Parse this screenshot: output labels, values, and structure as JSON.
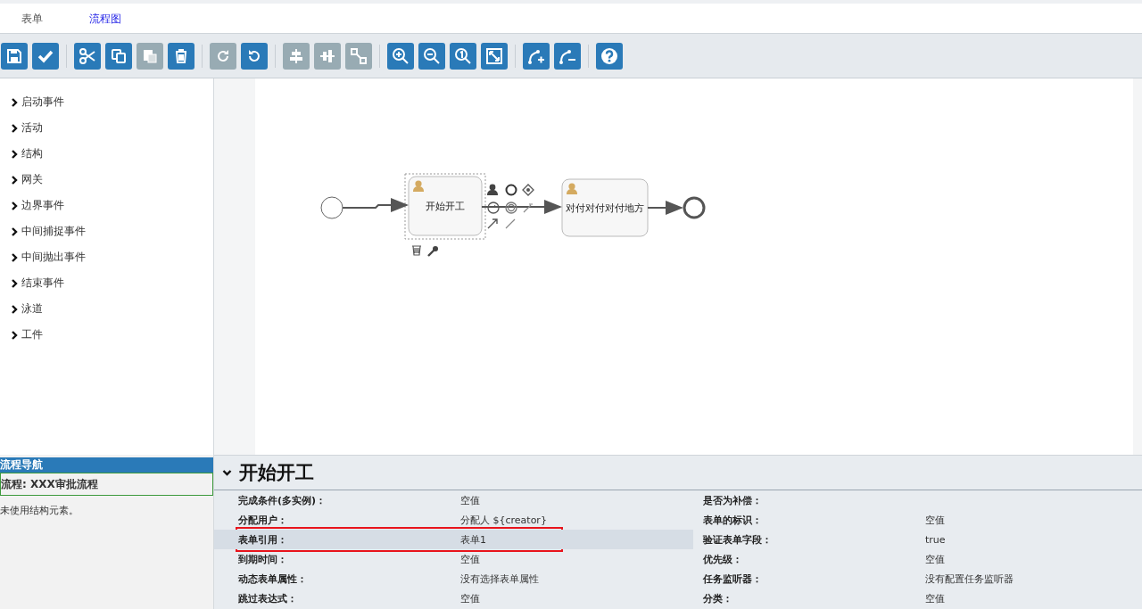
{
  "tabs": [
    {
      "label": "表单",
      "selected": false
    },
    {
      "label": "流程图",
      "selected": true
    }
  ],
  "toolbar": [
    [
      {
        "kind": "save",
        "disabled": false
      },
      {
        "kind": "validate",
        "disabled": false
      }
    ],
    [
      {
        "kind": "cut",
        "disabled": false
      },
      {
        "kind": "copy",
        "disabled": false
      },
      {
        "kind": "paste",
        "disabled": true
      },
      {
        "kind": "delete",
        "disabled": false
      }
    ],
    [
      {
        "kind": "redo",
        "disabled": true
      },
      {
        "kind": "undo",
        "disabled": false
      }
    ],
    [
      {
        "kind": "align-horizontal",
        "disabled": true
      },
      {
        "kind": "align-vertical",
        "disabled": true
      },
      {
        "kind": "same-size",
        "disabled": true
      }
    ],
    [
      {
        "kind": "zoom-in",
        "disabled": false
      },
      {
        "kind": "zoom-out",
        "disabled": false
      },
      {
        "kind": "zoom-actual",
        "disabled": false
      },
      {
        "kind": "zoom-fit",
        "disabled": false
      }
    ],
    [
      {
        "kind": "add-bendpoint",
        "disabled": false
      },
      {
        "kind": "remove-bendpoint",
        "disabled": false
      }
    ],
    [
      {
        "kind": "help",
        "disabled": false
      }
    ]
  ],
  "palette": [
    {
      "label": "启动事件",
      "expanded": false
    },
    {
      "label": "活动",
      "expanded": false
    },
    {
      "label": "结构",
      "expanded": false
    },
    {
      "label": "网关",
      "expanded": false
    },
    {
      "label": "边界事件",
      "expanded": false
    },
    {
      "label": "中间捕捉事件",
      "expanded": false
    },
    {
      "label": "中间抛出事件",
      "expanded": false
    },
    {
      "label": "结束事件",
      "expanded": false
    },
    {
      "label": "泳道",
      "expanded": false
    },
    {
      "label": "工件",
      "expanded": false
    }
  ],
  "diagram": {
    "nodes": [
      {
        "kind": "start-event"
      },
      {
        "kind": "user-task",
        "label": "开始开工",
        "selected": true
      },
      {
        "kind": "user-task",
        "label": "对付对付对付地方",
        "selected": false
      },
      {
        "kind": "end-event"
      }
    ]
  },
  "navigator": {
    "title": "流程导航",
    "process": "流程: XXX审批流程",
    "message": "未使用结构元素。"
  },
  "properties": {
    "title": "开始开工",
    "expanded": true,
    "items": [
      {
        "label": "完成条件(多实例)：",
        "value": "空值",
        "selected": false
      },
      {
        "label": "是否为补偿：",
        "selected": false
      },
      {
        "label": "分配用户：",
        "value": "分配人 ${creator}",
        "selected": false
      },
      {
        "label": "表单的标识：",
        "value": "空值",
        "selected": false
      },
      {
        "label": "表单引用：",
        "value": "表单1",
        "selected": true
      },
      {
        "label": "验证表单字段：",
        "value": "true",
        "selected": false
      },
      {
        "label": "到期时间：",
        "value": "空值",
        "selected": false
      },
      {
        "label": "优先级：",
        "value": "空值",
        "selected": false
      },
      {
        "label": "动态表单属性：",
        "value": "没有选择表单属性",
        "selected": false
      },
      {
        "label": "任务监听器：",
        "value": "没有配置任务监听器",
        "selected": false
      },
      {
        "label": "跳过表达式：",
        "value": "空值",
        "selected": false
      },
      {
        "label": "分类：",
        "value": "空值",
        "selected": false
      }
    ]
  }
}
